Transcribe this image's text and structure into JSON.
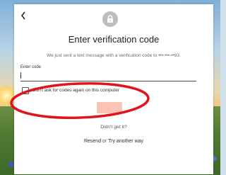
{
  "dialog": {
    "back_icon": "back-arrow-icon",
    "lock_icon": "lock-icon",
    "title": "Enter verification code",
    "subtitle": "We just sent a text message with a verification code to •••-•••-••93.",
    "code_field": {
      "label": "Enter code",
      "value": "",
      "placeholder": ""
    },
    "remember_checkbox": {
      "label": "Don't ask for codes again on this computer",
      "checked": false
    },
    "verify_button": {
      "label": ""
    },
    "didnt_get": "Didn't get it?",
    "resend_label": "Resend",
    "or_text": "or",
    "try_another_label": "Try another way"
  },
  "annotation": {
    "shape": "oval",
    "color": "#e0141e"
  },
  "colors": {
    "button_disabled": "#fac3b3",
    "card": "#ffffff",
    "badge": "#bdbdbd"
  }
}
